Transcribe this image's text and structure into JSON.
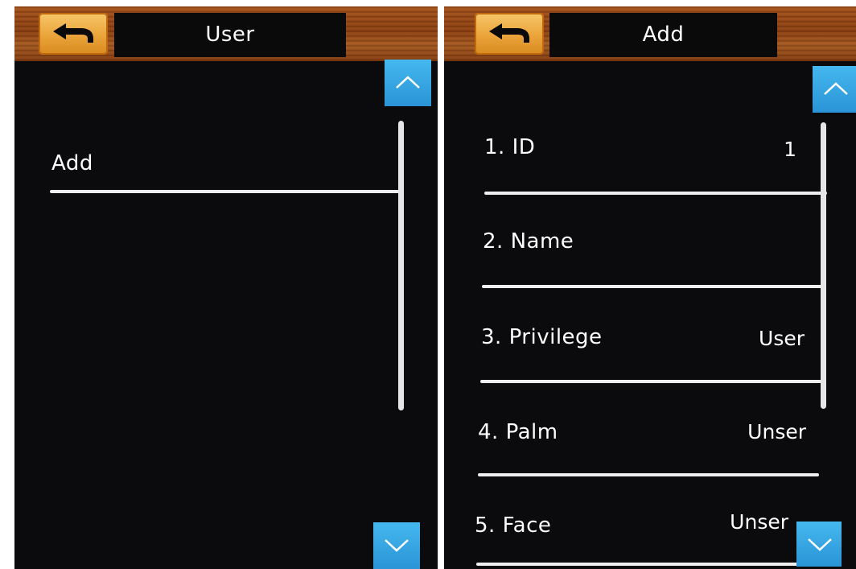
{
  "left_screen": {
    "title": "User",
    "back_icon": "back-arrow-icon",
    "items": [
      {
        "label": "Add"
      }
    ],
    "scroll_up_icon": "chevron-up-icon",
    "scroll_down_icon": "chevron-down-icon"
  },
  "right_screen": {
    "title": "Add",
    "back_icon": "back-arrow-icon",
    "fields": [
      {
        "label": "1. ID",
        "value": "1"
      },
      {
        "label": "2. Name",
        "value": ""
      },
      {
        "label": "3. Privilege",
        "value": "User"
      },
      {
        "label": "4. Palm",
        "value": "Unser"
      },
      {
        "label": "5. Face",
        "value": "Unser"
      }
    ],
    "scroll_up_icon": "chevron-up-icon",
    "scroll_down_icon": "chevron-down-icon"
  },
  "colors": {
    "header_wood": "#8a3f12",
    "back_button": "#eaa43a",
    "scroll_button": "#2a94d6",
    "background": "#0b0b0d",
    "text": "#ffffff"
  }
}
